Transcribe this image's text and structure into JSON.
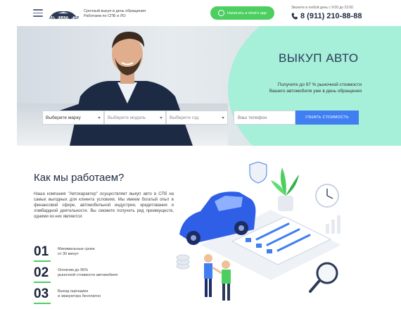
{
  "header": {
    "logo_text": "АВТОХАРАКТЕР",
    "tagline_line1": "Срочный выкуп в день обращения",
    "tagline_line2": "Работаем по СПБ и ЛО",
    "whatsapp_label": "Написать в what's app",
    "call_note": "Звоните в любой день с 9:00 до 22:00",
    "phone": "8 (911) 210-88-88"
  },
  "hero": {
    "title": "ВЫКУП АВТО",
    "sub_line1": "Получите до 97 % рыночной стоимости",
    "sub_line2": "Вашего автомобиля уже в день обращения"
  },
  "form": {
    "brand_value": "Выберите марку",
    "model_placeholder": "Выберите модель",
    "year_placeholder": "Выберите год",
    "phone_placeholder": "Ваш телефон",
    "submit_label": "УЗНАТЬ СТОИМОСТЬ"
  },
  "how": {
    "title": "Как мы работаем?",
    "text": "Наша компания \"Автохарактер\" осуществляет выкуп авто в СПб на самых выгодных для клиента условиях. Мы имеем богатый опыт в финансовой сфере, автомобильной индустрии, кредитования и ломбардной деятельности. Вы сможете получить ряд преимуществ, одними из них являются:",
    "steps": [
      {
        "num": "01",
        "line1": "Минимальные сроки",
        "line2": "от 30 минут"
      },
      {
        "num": "02",
        "line1": "Оплатим до 95%",
        "line2": "рыночной стоимости автомобиля"
      },
      {
        "num": "03",
        "line1": "Выезд оценщика",
        "line2": "и эвакуатора бесплатно"
      }
    ]
  },
  "colors": {
    "accent_green": "#4ccf60",
    "button_blue": "#3f7ff1",
    "hero_mint": "#a6efd9",
    "dark_text": "#1d2a3d"
  }
}
